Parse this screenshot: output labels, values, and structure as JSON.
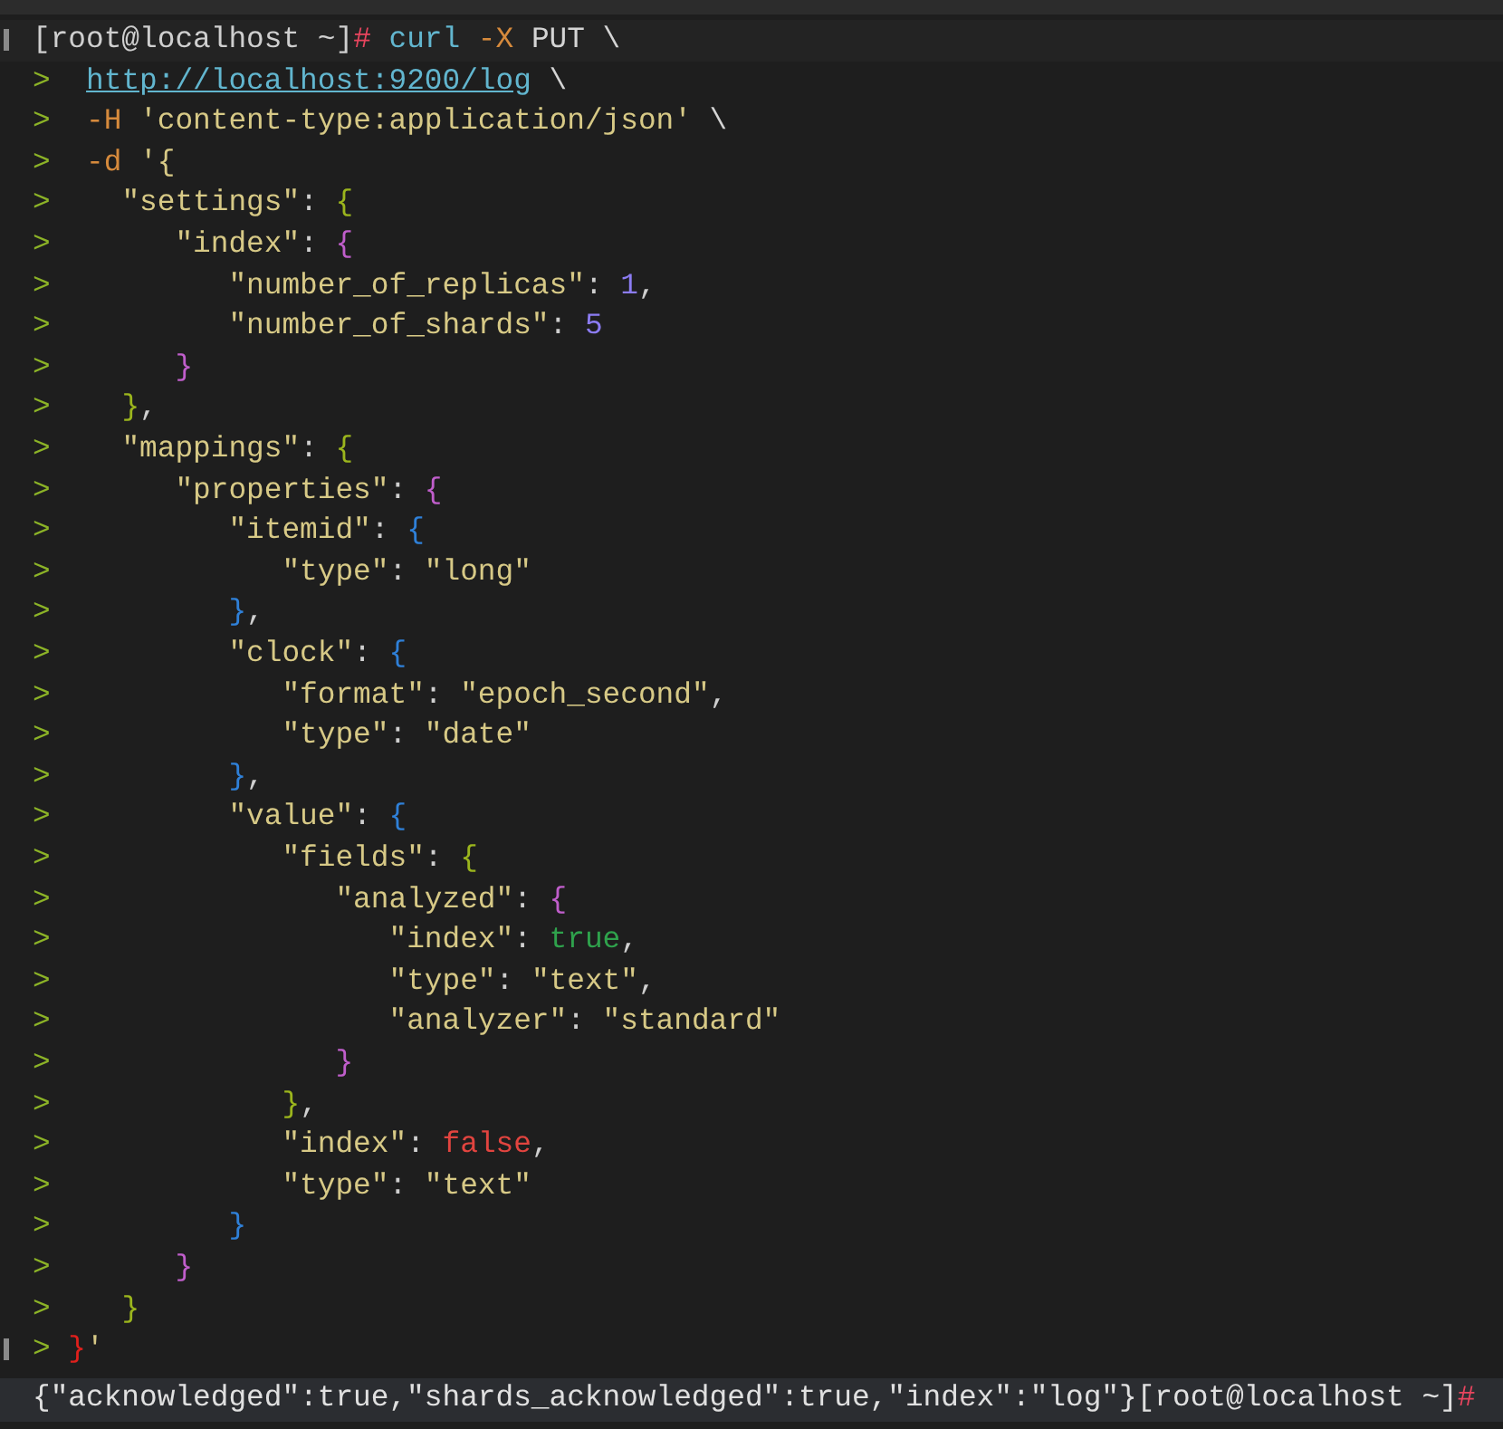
{
  "lines": [
    {
      "kind": "command",
      "marked": true,
      "tokens": [
        {
          "t": "[root@localhost ~]",
          "kind": "prompt"
        },
        {
          "t": "#",
          "kind": "hash"
        },
        {
          "t": " curl",
          "kind": "cmd"
        },
        {
          "t": " -X",
          "kind": "flag"
        },
        {
          "t": " PUT \\",
          "kind": "plain"
        }
      ]
    },
    {
      "kind": "continuation",
      "tokens": [
        {
          "t": ">  ",
          "kind": "cont"
        },
        {
          "t": "http://localhost:9200/log",
          "kind": "url"
        },
        {
          "t": " \\",
          "kind": "plain"
        }
      ]
    },
    {
      "kind": "continuation",
      "tokens": [
        {
          "t": ">",
          "kind": "cont"
        },
        {
          "t": "  -H",
          "kind": "flag"
        },
        {
          "t": " 'content-type:application/json'",
          "kind": "str"
        },
        {
          "t": " \\",
          "kind": "plain"
        }
      ]
    },
    {
      "kind": "continuation",
      "tokens": [
        {
          "t": ">",
          "kind": "cont"
        },
        {
          "t": "  -d",
          "kind": "flag"
        },
        {
          "t": " '{",
          "kind": "str"
        }
      ]
    },
    {
      "kind": "continuation",
      "tokens": [
        {
          "t": ">",
          "kind": "cont"
        },
        {
          "t": "    \"settings\"",
          "kind": "str"
        },
        {
          "t": ": ",
          "kind": "punct"
        },
        {
          "t": "{",
          "kind": "b1"
        }
      ]
    },
    {
      "kind": "continuation",
      "tokens": [
        {
          "t": ">",
          "kind": "cont"
        },
        {
          "t": "       \"index\"",
          "kind": "str"
        },
        {
          "t": ": ",
          "kind": "punct"
        },
        {
          "t": "{",
          "kind": "b2"
        }
      ]
    },
    {
      "kind": "continuation",
      "tokens": [
        {
          "t": ">",
          "kind": "cont"
        },
        {
          "t": "          \"number_of_replicas\"",
          "kind": "str"
        },
        {
          "t": ": ",
          "kind": "punct"
        },
        {
          "t": "1",
          "kind": "num"
        },
        {
          "t": ",",
          "kind": "punct"
        }
      ]
    },
    {
      "kind": "continuation",
      "tokens": [
        {
          "t": ">",
          "kind": "cont"
        },
        {
          "t": "          \"number_of_shards\"",
          "kind": "str"
        },
        {
          "t": ": ",
          "kind": "punct"
        },
        {
          "t": "5",
          "kind": "num"
        }
      ]
    },
    {
      "kind": "continuation",
      "tokens": [
        {
          "t": ">",
          "kind": "cont"
        },
        {
          "t": "       }",
          "kind": "b2"
        }
      ]
    },
    {
      "kind": "continuation",
      "tokens": [
        {
          "t": ">",
          "kind": "cont"
        },
        {
          "t": "    }",
          "kind": "b1"
        },
        {
          "t": ",",
          "kind": "punct"
        }
      ]
    },
    {
      "kind": "continuation",
      "tokens": [
        {
          "t": ">",
          "kind": "cont"
        },
        {
          "t": "    \"mappings\"",
          "kind": "str"
        },
        {
          "t": ": ",
          "kind": "punct"
        },
        {
          "t": "{",
          "kind": "b1"
        }
      ]
    },
    {
      "kind": "continuation",
      "tokens": [
        {
          "t": ">",
          "kind": "cont"
        },
        {
          "t": "       \"properties\"",
          "kind": "str"
        },
        {
          "t": ": ",
          "kind": "punct"
        },
        {
          "t": "{",
          "kind": "b2"
        }
      ]
    },
    {
      "kind": "continuation",
      "tokens": [
        {
          "t": ">",
          "kind": "cont"
        },
        {
          "t": "          \"itemid\"",
          "kind": "str"
        },
        {
          "t": ": ",
          "kind": "punct"
        },
        {
          "t": "{",
          "kind": "b3"
        }
      ]
    },
    {
      "kind": "continuation",
      "tokens": [
        {
          "t": ">",
          "kind": "cont"
        },
        {
          "t": "             \"type\"",
          "kind": "str"
        },
        {
          "t": ": ",
          "kind": "punct"
        },
        {
          "t": "\"long\"",
          "kind": "str"
        }
      ]
    },
    {
      "kind": "continuation",
      "tokens": [
        {
          "t": ">",
          "kind": "cont"
        },
        {
          "t": "          }",
          "kind": "b3"
        },
        {
          "t": ",",
          "kind": "punct"
        }
      ]
    },
    {
      "kind": "continuation",
      "tokens": [
        {
          "t": ">",
          "kind": "cont"
        },
        {
          "t": "          \"clock\"",
          "kind": "str"
        },
        {
          "t": ": ",
          "kind": "punct"
        },
        {
          "t": "{",
          "kind": "b3"
        }
      ]
    },
    {
      "kind": "continuation",
      "tokens": [
        {
          "t": ">",
          "kind": "cont"
        },
        {
          "t": "             \"format\"",
          "kind": "str"
        },
        {
          "t": ": ",
          "kind": "punct"
        },
        {
          "t": "\"epoch_second\"",
          "kind": "str"
        },
        {
          "t": ",",
          "kind": "punct"
        }
      ]
    },
    {
      "kind": "continuation",
      "tokens": [
        {
          "t": ">",
          "kind": "cont"
        },
        {
          "t": "             \"type\"",
          "kind": "str"
        },
        {
          "t": ": ",
          "kind": "punct"
        },
        {
          "t": "\"date\"",
          "kind": "str"
        }
      ]
    },
    {
      "kind": "continuation",
      "tokens": [
        {
          "t": ">",
          "kind": "cont"
        },
        {
          "t": "          }",
          "kind": "b3"
        },
        {
          "t": ",",
          "kind": "punct"
        }
      ]
    },
    {
      "kind": "continuation",
      "tokens": [
        {
          "t": ">",
          "kind": "cont"
        },
        {
          "t": "          \"value\"",
          "kind": "str"
        },
        {
          "t": ": ",
          "kind": "punct"
        },
        {
          "t": "{",
          "kind": "b3"
        }
      ]
    },
    {
      "kind": "continuation",
      "tokens": [
        {
          "t": ">",
          "kind": "cont"
        },
        {
          "t": "             \"fields\"",
          "kind": "str"
        },
        {
          "t": ": ",
          "kind": "punct"
        },
        {
          "t": "{",
          "kind": "b1"
        }
      ]
    },
    {
      "kind": "continuation",
      "tokens": [
        {
          "t": ">",
          "kind": "cont"
        },
        {
          "t": "                \"analyzed\"",
          "kind": "str"
        },
        {
          "t": ": ",
          "kind": "punct"
        },
        {
          "t": "{",
          "kind": "b2"
        }
      ]
    },
    {
      "kind": "continuation",
      "tokens": [
        {
          "t": ">",
          "kind": "cont"
        },
        {
          "t": "                   \"index\"",
          "kind": "str"
        },
        {
          "t": ": ",
          "kind": "punct"
        },
        {
          "t": "true",
          "kind": "true"
        },
        {
          "t": ",",
          "kind": "punct"
        }
      ]
    },
    {
      "kind": "continuation",
      "tokens": [
        {
          "t": ">",
          "kind": "cont"
        },
        {
          "t": "                   \"type\"",
          "kind": "str"
        },
        {
          "t": ": ",
          "kind": "punct"
        },
        {
          "t": "\"text\"",
          "kind": "str"
        },
        {
          "t": ",",
          "kind": "punct"
        }
      ]
    },
    {
      "kind": "continuation",
      "tokens": [
        {
          "t": ">",
          "kind": "cont"
        },
        {
          "t": "                   \"analyzer\"",
          "kind": "str"
        },
        {
          "t": ": ",
          "kind": "punct"
        },
        {
          "t": "\"standard\"",
          "kind": "str"
        }
      ]
    },
    {
      "kind": "continuation",
      "tokens": [
        {
          "t": ">",
          "kind": "cont"
        },
        {
          "t": "                }",
          "kind": "b2"
        }
      ]
    },
    {
      "kind": "continuation",
      "tokens": [
        {
          "t": ">",
          "kind": "cont"
        },
        {
          "t": "             }",
          "kind": "b1"
        },
        {
          "t": ",",
          "kind": "punct"
        }
      ]
    },
    {
      "kind": "continuation",
      "tokens": [
        {
          "t": ">",
          "kind": "cont"
        },
        {
          "t": "             \"index\"",
          "kind": "str"
        },
        {
          "t": ": ",
          "kind": "punct"
        },
        {
          "t": "false",
          "kind": "false"
        },
        {
          "t": ",",
          "kind": "punct"
        }
      ]
    },
    {
      "kind": "continuation",
      "tokens": [
        {
          "t": ">",
          "kind": "cont"
        },
        {
          "t": "             \"type\"",
          "kind": "str"
        },
        {
          "t": ": ",
          "kind": "punct"
        },
        {
          "t": "\"text\"",
          "kind": "str"
        }
      ]
    },
    {
      "kind": "continuation",
      "tokens": [
        {
          "t": ">",
          "kind": "cont"
        },
        {
          "t": "          }",
          "kind": "b3"
        }
      ]
    },
    {
      "kind": "continuation",
      "tokens": [
        {
          "t": ">",
          "kind": "cont"
        },
        {
          "t": "       }",
          "kind": "b2"
        }
      ]
    },
    {
      "kind": "continuation",
      "tokens": [
        {
          "t": ">",
          "kind": "cont"
        },
        {
          "t": "    }",
          "kind": "b1"
        }
      ]
    },
    {
      "kind": "continuation",
      "marked": true,
      "tokens": [
        {
          "t": ">",
          "kind": "cont"
        },
        {
          "t": " }",
          "kind": "err"
        },
        {
          "t": "'",
          "kind": "str"
        }
      ]
    },
    {
      "kind": "output",
      "tokens": [
        {
          "t": "{\"acknowledged\":true,\"shards_acknowledged\":true,\"index\":\"log\"}[root@localhost ~]",
          "kind": "out"
        },
        {
          "t": "#",
          "kind": "hash"
        }
      ]
    }
  ]
}
